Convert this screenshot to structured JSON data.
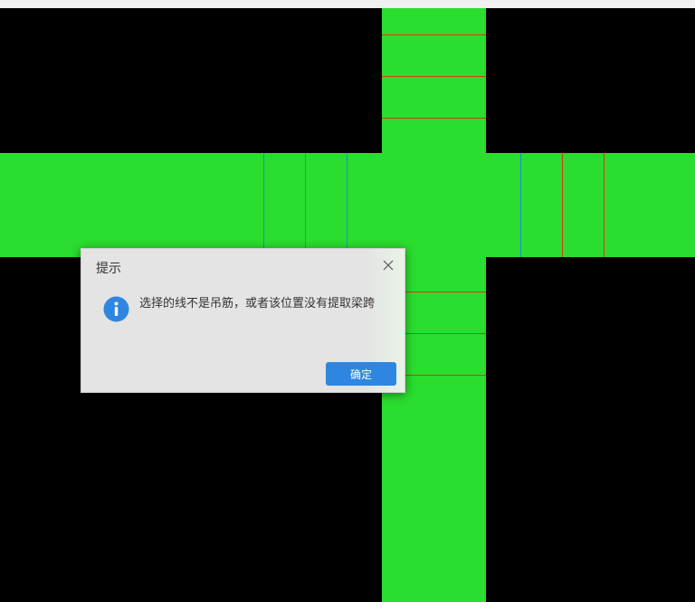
{
  "colors": {
    "background": "#000000",
    "beam_fill": "#2add2e",
    "stirrup_red": "#d43a1a",
    "rebar_blue": "#1a8fd8",
    "dialog_bg": "#e4e4e4",
    "primary_button": "#2f86e0"
  },
  "dialog": {
    "title": "提示",
    "message": "选择的线不是吊筋，或者该位置没有提取梁跨",
    "ok_label": "确定",
    "icon": "info-icon",
    "close_icon": "close-icon"
  }
}
